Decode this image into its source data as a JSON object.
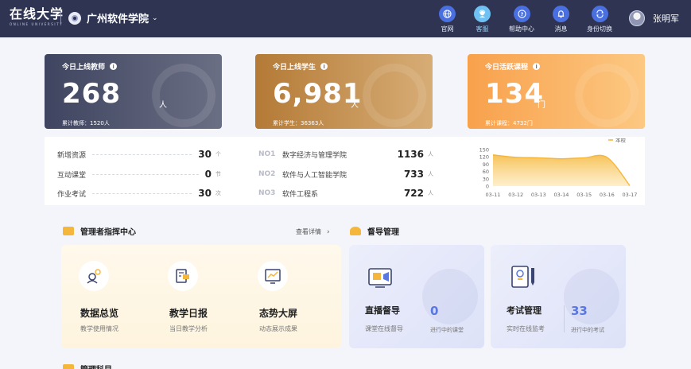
{
  "header": {
    "logo_main": "在线大学",
    "logo_sub": "ONLINE UNIVERSITY",
    "school_name": "广州软件学院",
    "nav": [
      {
        "label": "官网",
        "icon": "globe-icon"
      },
      {
        "label": "客服",
        "icon": "customer-service-icon"
      },
      {
        "label": "帮助中心",
        "icon": "help-icon"
      },
      {
        "label": "消息",
        "icon": "bell-icon"
      },
      {
        "label": "身份切换",
        "icon": "switch-icon"
      }
    ],
    "user_name": "张明军"
  },
  "stats": [
    {
      "title": "今日上线教师",
      "value": "268",
      "unit": "人",
      "footer": "累计教师：1520人"
    },
    {
      "title": "今日上线学生",
      "value": "6,981",
      "unit": "人",
      "footer": "累计学生：36363人"
    },
    {
      "title": "今日活跃课程",
      "value": "134",
      "unit": "门",
      "footer": "累计课程：4732门"
    }
  ],
  "summary": {
    "items": [
      {
        "label": "新增资源",
        "value": "30",
        "unit": "个"
      },
      {
        "label": "互动课堂",
        "value": "0",
        "unit": "节"
      },
      {
        "label": "作业考试",
        "value": "30",
        "unit": "次"
      }
    ],
    "ranking": [
      {
        "rank": "NO1",
        "name": "数字经济与管理学院",
        "value": "1136",
        "unit": "人"
      },
      {
        "rank": "NO2",
        "name": "软件与人工智能学院",
        "value": "733",
        "unit": "人"
      },
      {
        "rank": "NO3",
        "name": "软件工程系",
        "value": "722",
        "unit": "人"
      }
    ]
  },
  "chart_data": {
    "type": "area",
    "x": [
      "03-11",
      "03-12",
      "03-13",
      "03-14",
      "03-15",
      "03-16",
      "03-17"
    ],
    "series": [
      {
        "name": "本校",
        "values": [
          128,
          118,
          116,
          112,
          116,
          118,
          2
        ]
      }
    ],
    "ylim": [
      0,
      150
    ],
    "yticks": [
      "150",
      "120",
      "90",
      "60",
      "30",
      "0"
    ],
    "legend": "top-right",
    "color": "#f5b73b"
  },
  "admin_center": {
    "title": "管理者指挥中心",
    "more": "查看详情",
    "tools": [
      {
        "name": "数据总览",
        "desc": "教学使用情况"
      },
      {
        "name": "教学日报",
        "desc": "当日教学分析"
      },
      {
        "name": "态势大屏",
        "desc": "动态展示成果"
      }
    ]
  },
  "supervision": {
    "title": "督导管理",
    "cards": [
      {
        "name": "直播督导",
        "desc": "课堂在线督导",
        "count": "0",
        "count_label": "进行中的课堂"
      },
      {
        "name": "考试管理",
        "desc": "实时在线监考",
        "count": "33",
        "count_label": "进行中的考试"
      }
    ]
  },
  "bottom_section_title": "管理科目"
}
